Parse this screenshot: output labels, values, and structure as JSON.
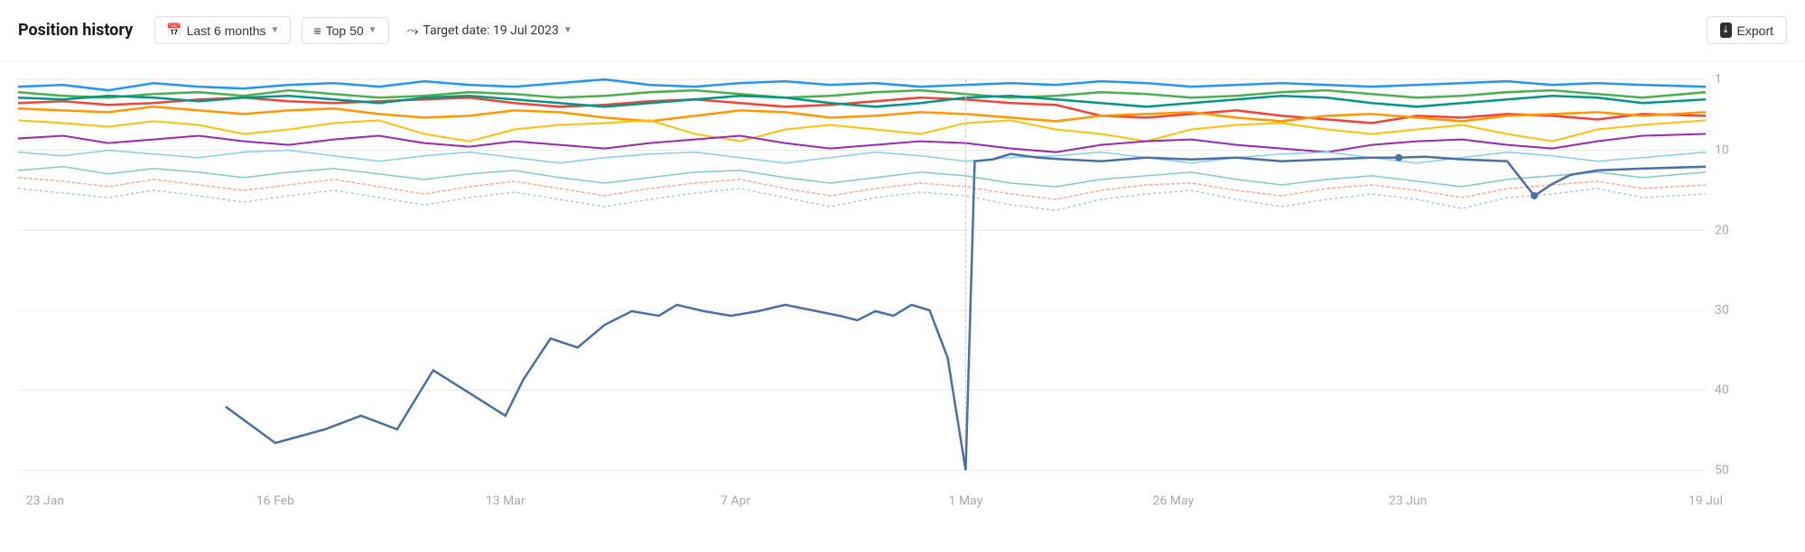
{
  "toolbar": {
    "title": "Position history",
    "period_label": "Last 6 months",
    "top_label": "Top 50",
    "target_label": "Target date: 19 Jul 2023",
    "export_label": "Export"
  },
  "chart": {
    "x_labels": [
      "23 Jan",
      "16 Feb",
      "13 Mar",
      "7 Apr",
      "1 May",
      "26 May",
      "23 Jun",
      "19 Jul"
    ],
    "y_labels": [
      "1",
      "10",
      "20",
      "30",
      "40",
      "50"
    ],
    "accent_color": "#4a6fa5"
  }
}
